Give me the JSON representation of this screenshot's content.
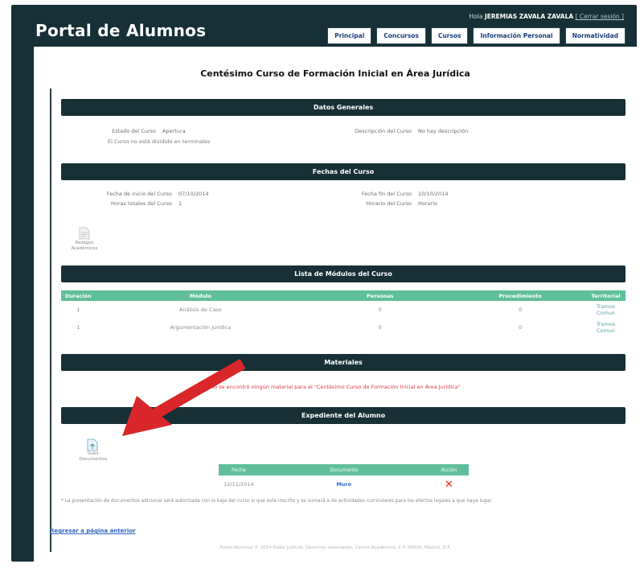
{
  "header": {
    "app_title": "Portal de Alumnos",
    "greeting": "Hola",
    "user_name": "JEREMIAS ZAVALA ZAVALA",
    "logout_label": "[ Cerrar sesión ]",
    "nav": [
      "Principal",
      "Concursos",
      "Cursos",
      "Información Personal",
      "Normatividad"
    ]
  },
  "course_title": "Centésimo Curso de Formación Inicial en Área Jurídica",
  "datos_generales": {
    "heading": "Datos Generales",
    "estado_label": "Estado del Curso",
    "estado_value": "Apertura",
    "descripcion_label": "Descripción del Curso",
    "descripcion_value": "No hay descripción",
    "note": "El Curso no está dividido en terminales"
  },
  "fechas": {
    "heading": "Fechas del Curso",
    "inicio_label": "Fecha de inicio del Curso",
    "inicio_value": "07/10/2014",
    "fin_label": "Fecha fin del Curso",
    "fin_value": "10/10/2014",
    "horas_label": "Horas totales del Curso",
    "horas_value": "1",
    "horario_label": "Horario del Curso",
    "horario_value": "Horario",
    "icon_label": "Rezagos Académicos"
  },
  "modulos": {
    "heading": "Lista de Módulos del Curso",
    "columns": [
      "Duración",
      "Módulo",
      "Personas",
      "Procedimiento",
      "Territorial"
    ],
    "rows": [
      {
        "duracion": "1",
        "modulo": "Análisis de Caso",
        "personas": "0",
        "procedimiento": "0",
        "territorial": "Tramos Comun"
      },
      {
        "duracion": "1",
        "modulo": "Argumentación Jurídica",
        "personas": "0",
        "procedimiento": "0",
        "territorial": "Tramos Comun"
      }
    ]
  },
  "materiales": {
    "heading": "Materiales",
    "message": "No se encontró ningún material para el \"Centésimo Curso de Formación Inicial en Área Jurídica\""
  },
  "expediente": {
    "heading": "Expediente del Alumno",
    "icon_label": "Subir Documentos",
    "columns": [
      "Fecha",
      "Documento",
      "Acción"
    ],
    "rows": [
      {
        "fecha": "12/11/2014",
        "documento": "Muro",
        "accion": "✕"
      }
    ],
    "footnote": "* La presentación de documentos adicional será autorizada con la baja del curso si que este inscrito y se sumará a de actividades curriculares para los efectos legales a que haya lugar."
  },
  "back_link": "Regresar a página anterior",
  "footer": "Portal Alumnos © 2014 Poder Judicial, Derechos reservados, Centro Académico, C.P. 00000, México, D.F.",
  "colors": {
    "header_bg": "#153036",
    "table_header": "#5fbf9a",
    "error": "#d33c45",
    "link": "#2f66c4",
    "arrow": "#d9262a"
  }
}
